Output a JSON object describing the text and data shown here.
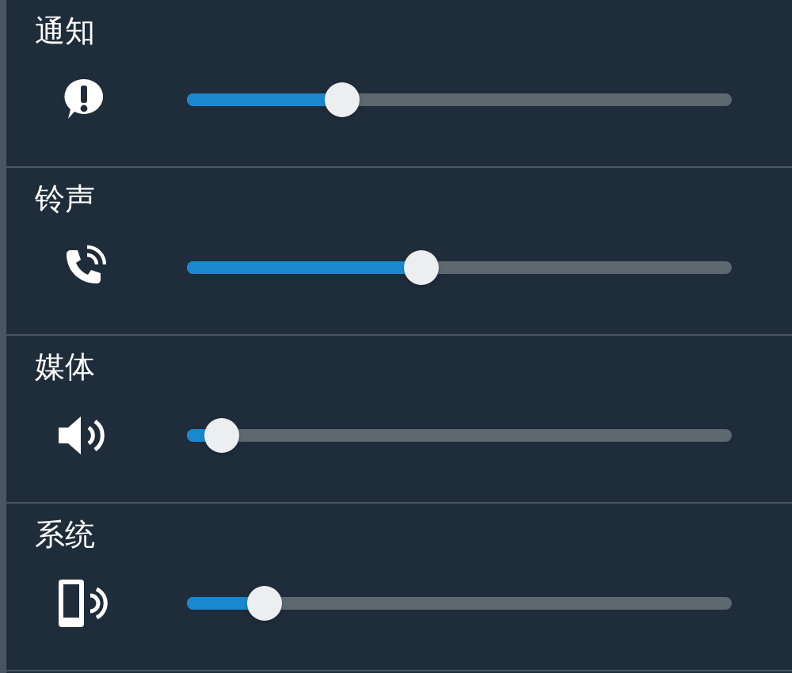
{
  "channels": [
    {
      "name": "通知",
      "kind": "notification",
      "level": 0.285
    },
    {
      "name": "铃声",
      "kind": "ringtone",
      "level": 0.43
    },
    {
      "name": "媒体",
      "kind": "media",
      "level": 0.064
    },
    {
      "name": "系统",
      "kind": "system",
      "level": 0.142
    }
  ]
}
